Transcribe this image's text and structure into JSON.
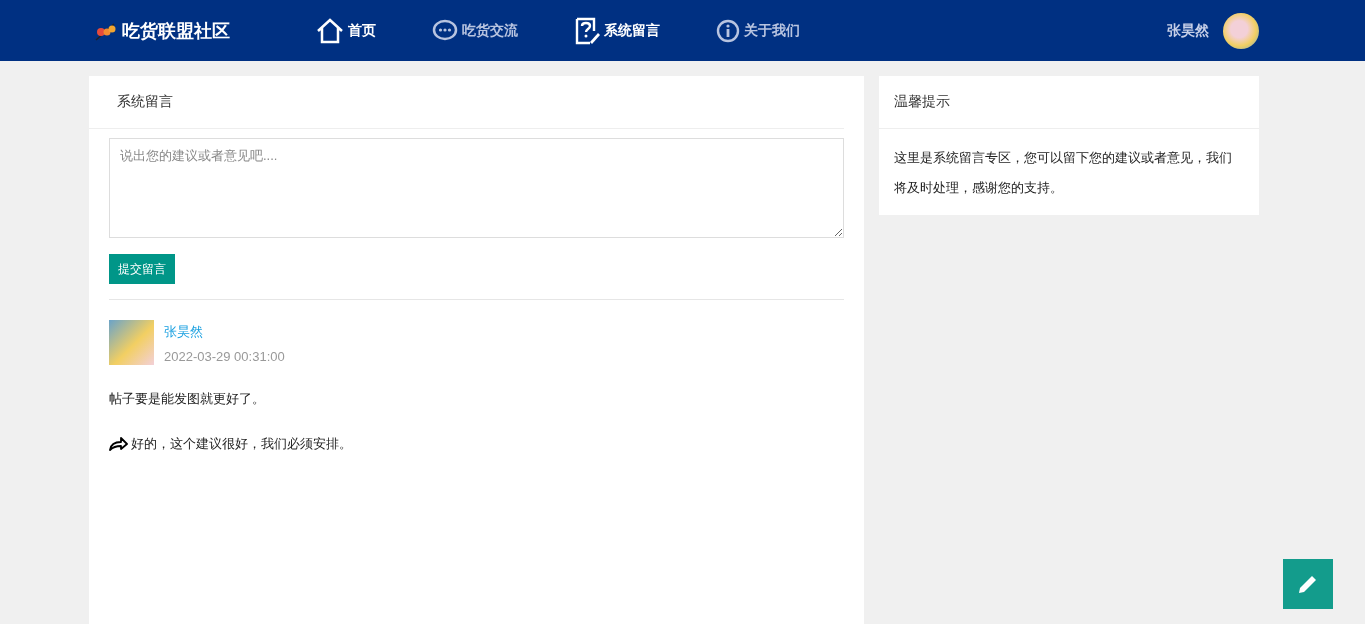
{
  "header": {
    "logo": "吃货联盟社区",
    "nav": [
      {
        "label": "首页",
        "bright": true
      },
      {
        "label": "吃货交流",
        "bright": false
      },
      {
        "label": "系统留言",
        "bright": true
      },
      {
        "label": "关于我们",
        "bright": false
      }
    ],
    "user": "张昊然"
  },
  "message_panel": {
    "title": "系统留言",
    "placeholder": "说出您的建议或者意见吧....",
    "submit": "提交留言",
    "messages": [
      {
        "author": "张昊然",
        "time": "2022-03-29 00:31:00",
        "text": "帖子要是能发图就更好了。",
        "reply": "好的，这个建议很好，我们必须安排。"
      }
    ]
  },
  "tip_panel": {
    "title": "温馨提示",
    "text": "这里是系统留言专区，您可以留下您的建议或者意见，我们将及时处理，感谢您的支持。"
  }
}
